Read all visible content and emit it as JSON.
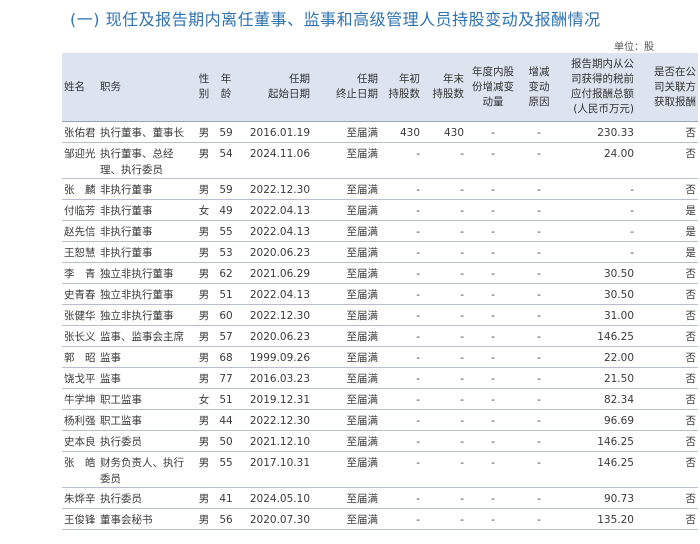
{
  "title": "(一) 现任及报告期内离任董事、监事和高级管理人员持股变动及报酬情况",
  "unit": "单位：股",
  "headers": {
    "name": "姓名",
    "role": "职务",
    "gender": "性\n别",
    "age": "年\n龄",
    "start": "任期\n起始日期",
    "end": "任期\n终止日期",
    "begin_shares": "年初\n持股数",
    "end_shares": "年末\n持股数",
    "change": "年度内股\n份增减变\n动量",
    "reason": "增减\n变动\n原因",
    "pay": "报告期内从公\n司获得的税前\n应付报酬总额\n(人民币万元)",
    "related": "是否在公\n司关联方\n获取报酬"
  },
  "rows": [
    {
      "name": "张佑君",
      "role": "执行董事、董事长",
      "gender": "男",
      "age": "59",
      "start": "2016.01.19",
      "end": "至届满",
      "begin": "430",
      "endn": "430",
      "change": "-",
      "reason": "-",
      "pay": "230.33",
      "related": "否"
    },
    {
      "name": "邹迎光",
      "role": "执行董事、总经理、执行委员",
      "gender": "男",
      "age": "54",
      "start": "2024.11.06",
      "end": "至届满",
      "begin": "-",
      "endn": "-",
      "change": "-",
      "reason": "-",
      "pay": "24.00",
      "related": "否"
    },
    {
      "name": "张　麟",
      "role": "非执行董事",
      "gender": "男",
      "age": "59",
      "start": "2022.12.30",
      "end": "至届满",
      "begin": "-",
      "endn": "-",
      "change": "-",
      "reason": "-",
      "pay": "-",
      "related": "否"
    },
    {
      "name": "付临芳",
      "role": "非执行董事",
      "gender": "女",
      "age": "49",
      "start": "2022.04.13",
      "end": "至届满",
      "begin": "-",
      "endn": "-",
      "change": "-",
      "reason": "-",
      "pay": "-",
      "related": "是"
    },
    {
      "name": "赵先信",
      "role": "非执行董事",
      "gender": "男",
      "age": "55",
      "start": "2022.04.13",
      "end": "至届满",
      "begin": "-",
      "endn": "-",
      "change": "-",
      "reason": "-",
      "pay": "-",
      "related": "是"
    },
    {
      "name": "王恕慧",
      "role": "非执行董事",
      "gender": "男",
      "age": "53",
      "start": "2020.06.23",
      "end": "至届满",
      "begin": "-",
      "endn": "-",
      "change": "-",
      "reason": "-",
      "pay": "-",
      "related": "是"
    },
    {
      "name": "李　青",
      "role": "独立非执行董事",
      "gender": "男",
      "age": "62",
      "start": "2021.06.29",
      "end": "至届满",
      "begin": "-",
      "endn": "-",
      "change": "-",
      "reason": "-",
      "pay": "30.50",
      "related": "否"
    },
    {
      "name": "史青春",
      "role": "独立非执行董事",
      "gender": "男",
      "age": "51",
      "start": "2022.04.13",
      "end": "至届满",
      "begin": "-",
      "endn": "-",
      "change": "-",
      "reason": "-",
      "pay": "30.50",
      "related": "否"
    },
    {
      "name": "张健华",
      "role": "独立非执行董事",
      "gender": "男",
      "age": "60",
      "start": "2022.12.30",
      "end": "至届满",
      "begin": "-",
      "endn": "-",
      "change": "-",
      "reason": "-",
      "pay": "31.00",
      "related": "否"
    },
    {
      "name": "张长义",
      "role": "监事、监事会主席",
      "gender": "男",
      "age": "57",
      "start": "2020.06.23",
      "end": "至届满",
      "begin": "-",
      "endn": "-",
      "change": "-",
      "reason": "-",
      "pay": "146.25",
      "related": "否"
    },
    {
      "name": "郭　昭",
      "role": "监事",
      "gender": "男",
      "age": "68",
      "start": "1999.09.26",
      "end": "至届满",
      "begin": "-",
      "endn": "-",
      "change": "-",
      "reason": "-",
      "pay": "22.00",
      "related": "否"
    },
    {
      "name": "饶戈平",
      "role": "监事",
      "gender": "男",
      "age": "77",
      "start": "2016.03.23",
      "end": "至届满",
      "begin": "-",
      "endn": "-",
      "change": "-",
      "reason": "-",
      "pay": "21.50",
      "related": "否"
    },
    {
      "name": "牛学坤",
      "role": "职工监事",
      "gender": "女",
      "age": "51",
      "start": "2019.12.31",
      "end": "至届满",
      "begin": "-",
      "endn": "-",
      "change": "-",
      "reason": "-",
      "pay": "82.34",
      "related": "否"
    },
    {
      "name": "杨利强",
      "role": "职工监事",
      "gender": "男",
      "age": "44",
      "start": "2022.12.30",
      "end": "至届满",
      "begin": "-",
      "endn": "-",
      "change": "-",
      "reason": "-",
      "pay": "96.69",
      "related": "否"
    },
    {
      "name": "史本良",
      "role": "执行委员",
      "gender": "男",
      "age": "50",
      "start": "2021.12.10",
      "end": "至届满",
      "begin": "-",
      "endn": "-",
      "change": "-",
      "reason": "-",
      "pay": "146.25",
      "related": "否"
    },
    {
      "name": "张　皓",
      "role": "财务负责人、执行委员",
      "gender": "男",
      "age": "55",
      "start": "2017.10.31",
      "end": "至届满",
      "begin": "-",
      "endn": "-",
      "change": "-",
      "reason": "-",
      "pay": "146.25",
      "related": "否"
    },
    {
      "name": "朱烨辛",
      "role": "执行委员",
      "gender": "男",
      "age": "41",
      "start": "2024.05.10",
      "end": "至届满",
      "begin": "-",
      "endn": "-",
      "change": "-",
      "reason": "-",
      "pay": "90.73",
      "related": "否"
    },
    {
      "name": "王俊锋",
      "role": "董事会秘书",
      "gender": "男",
      "age": "56",
      "start": "2020.07.30",
      "end": "至届满",
      "begin": "-",
      "endn": "-",
      "change": "-",
      "reason": "-",
      "pay": "135.20",
      "related": "否"
    }
  ]
}
